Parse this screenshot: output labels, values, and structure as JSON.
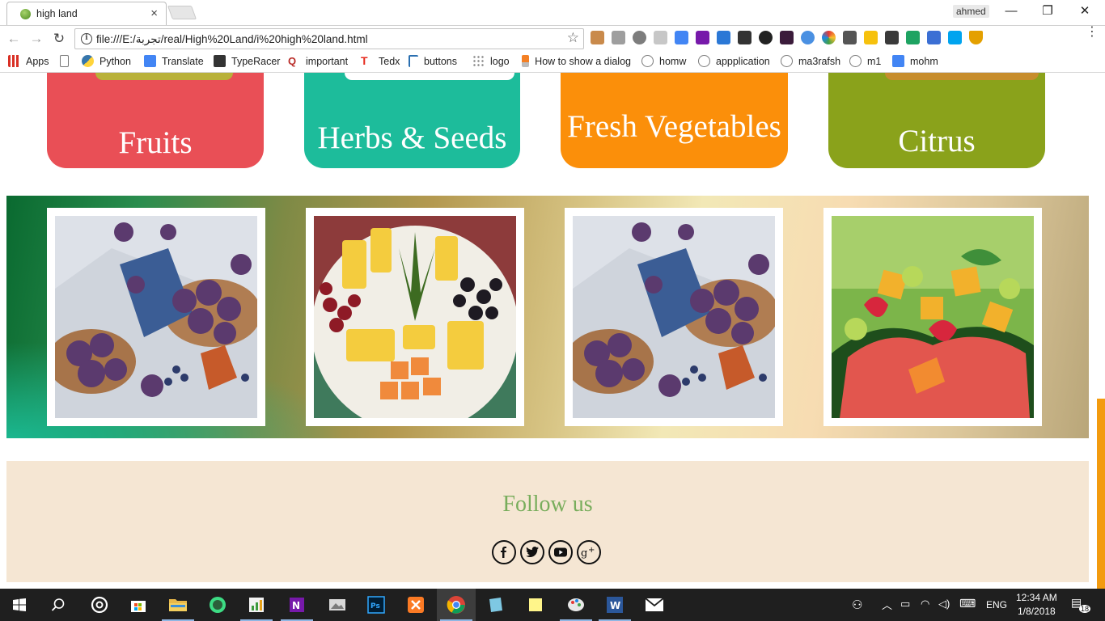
{
  "browser": {
    "tab_title": "high land",
    "tab_close": "×",
    "profile_name": "ahmed",
    "window": {
      "minimize": "—",
      "maximize": "❐",
      "close": "✕"
    },
    "url": "file:///E:/تجربة/real/High%20Land/i%20high%20land.html"
  },
  "bookmarks": [
    {
      "label": "Apps",
      "icon": "apps-grid-icon",
      "color": "#d93025"
    },
    {
      "label": "",
      "icon": "page-icon",
      "color": "#777777"
    },
    {
      "label": "Python",
      "icon": "python-icon",
      "color": "#3776ab"
    },
    {
      "label": "Translate",
      "icon": "translate-icon",
      "color": "#4285f4"
    },
    {
      "label": "TypeRacer",
      "icon": "typeracer-icon",
      "color": "#333333"
    },
    {
      "label": "important",
      "icon": "quora-icon",
      "color": "#b92b27"
    },
    {
      "label": "Tedx",
      "icon": "tedx-icon",
      "color": "#e62b1e"
    },
    {
      "label": "buttons",
      "icon": "buttons-icon",
      "color": "#2a6fb0"
    },
    {
      "label": "logo",
      "icon": "dots-icon",
      "color": "#888888"
    },
    {
      "label": "How to show a dialog",
      "icon": "stackoverflow-icon",
      "color": "#f48024"
    },
    {
      "label": "homw",
      "icon": "uwc-icon",
      "color": "#7a7a7a"
    },
    {
      "label": "appplication",
      "icon": "uwc-icon",
      "color": "#7a7a7a"
    },
    {
      "label": "ma3rafsh",
      "icon": "uwc-icon",
      "color": "#7a7a7a"
    },
    {
      "label": "m1",
      "icon": "uwc-icon",
      "color": "#7a7a7a"
    },
    {
      "label": "mohm",
      "icon": "docs-icon",
      "color": "#4285f4"
    }
  ],
  "categories": [
    {
      "label": "Fruits",
      "color": "#e94f56"
    },
    {
      "label": "Herbs & Seeds",
      "color": "#1dbc9b"
    },
    {
      "label": "Fresh Vegetables",
      "color": "#fb8f0a"
    },
    {
      "label": "Citrus",
      "color": "#8aa21b"
    }
  ],
  "gallery": [
    {
      "subject": "plums-bowls-photo"
    },
    {
      "subject": "fruit-platter-photo"
    },
    {
      "subject": "plums-bowls-photo"
    },
    {
      "subject": "fruit-salad-photo"
    }
  ],
  "footer": {
    "follow_text": "Follow us",
    "socials": [
      "facebook-icon",
      "twitter-icon",
      "youtube-icon",
      "google-plus-icon"
    ]
  },
  "taskbar": {
    "language": "ENG",
    "time": "12:34 AM",
    "date": "1/8/2018",
    "notifications": "18"
  }
}
